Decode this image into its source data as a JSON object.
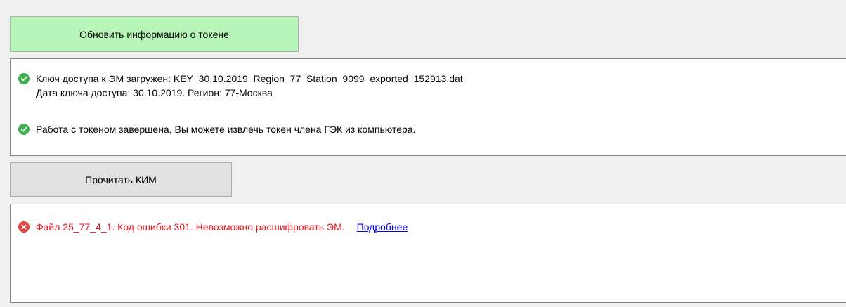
{
  "toolbar": {
    "refresh_label": "Обновить информацию о токене",
    "read_label": "Прочитать КИМ"
  },
  "token_panel": {
    "key_loaded": "Ключ доступа к ЭМ загружен: KEY_30.10.2019_Region_77_Station_9099_exported_152913.dat",
    "key_info": "Дата ключа доступа: 30.10.2019. Регион: 77-Москва",
    "token_done": "Работа с токеном завершена, Вы можете извлечь токен члена ГЭК из компьютера."
  },
  "error_panel": {
    "message": "Файл 25_77_4_1. Код ошибки 301. Невозможно расшифровать ЭМ.",
    "details_link": "Подробнее"
  },
  "colors": {
    "refresh_button_bg": "#b8f5b8",
    "success_icon": "#3daf4e",
    "error_icon": "#e0463c",
    "error_text": "#e8141b",
    "link": "#0000ee"
  },
  "icons": {
    "success": "check-circle-icon",
    "error": "x-circle-icon"
  }
}
